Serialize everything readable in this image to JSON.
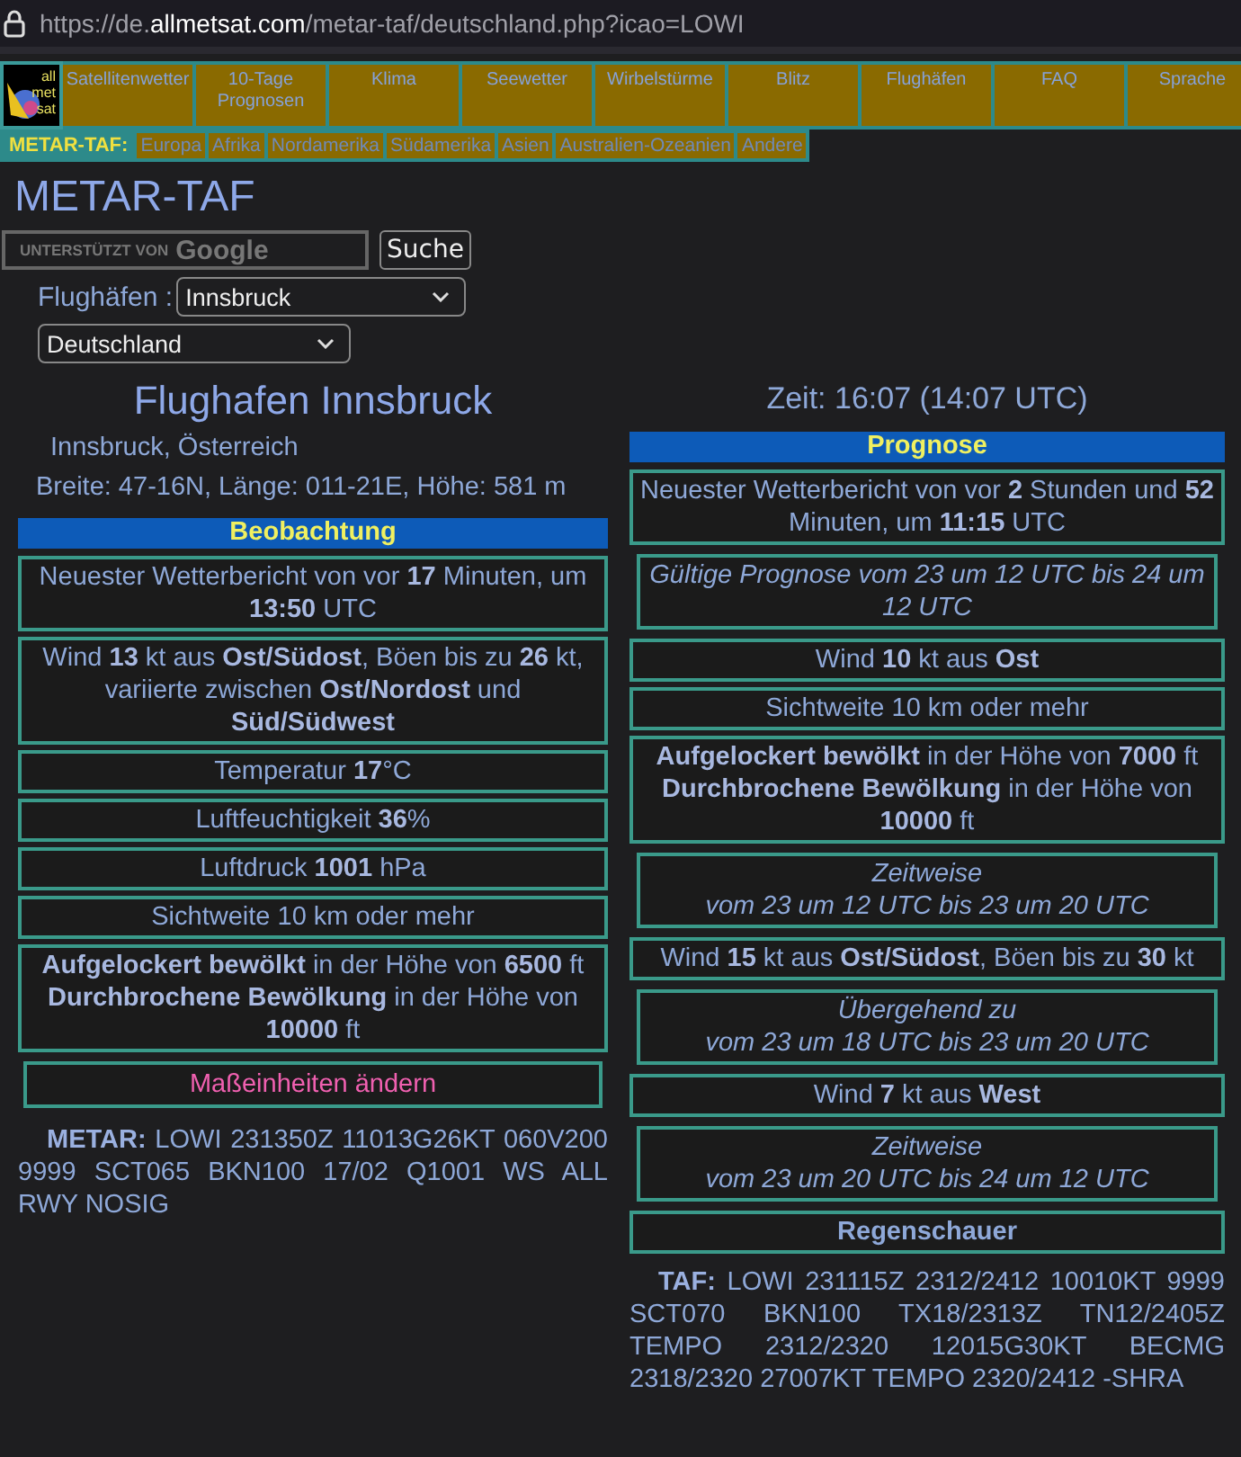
{
  "address_bar": {
    "url": "https://de.**allmetsat.com**/metar-taf/deutschland.php?icao=LOWI"
  },
  "logo": [
    "all",
    "met",
    "sat"
  ],
  "main_nav": [
    "Satellitenwetter",
    "10-Tage Prognosen",
    "Klima",
    "Seewetter",
    "Wirbelstürme",
    "Blitz",
    "Flughäfen",
    "FAQ",
    "Sprache"
  ],
  "sub_nav": {
    "label": "METAR-TAF:",
    "items": [
      "Europa",
      "Afrika",
      "Nordamerika",
      "Südamerika",
      "Asien",
      "Australien-Ozeanien",
      "Andere"
    ]
  },
  "page_title": "METAR-TAF",
  "search": {
    "placeholder": "UNTERSTÜTZT VON **Google**",
    "button": "Suche"
  },
  "airport_select": {
    "label": "Flughäfen :",
    "value": "Innsbruck"
  },
  "country_select": {
    "value": "Deutschland"
  },
  "observation": {
    "title": "Flughafen Innsbruck",
    "location": "Innsbruck, Österreich",
    "coordinates": "Breite: 47-16N, Länge: 011-21E, Höhe: 581 m",
    "section": "Beobachtung",
    "boxes": [
      {
        "kind": "info",
        "text": "Neuester Wetterbericht von vor **17** Minuten, um **13:50** UTC"
      },
      {
        "kind": "info",
        "text": "Wind **13** kt aus **Ost/Südost**, Böen bis zu **26** kt, variierte zwischen **Ost/Nordost** und **Süd/Südwest**"
      },
      {
        "kind": "info",
        "text": "Temperatur **17**°C"
      },
      {
        "kind": "info",
        "text": "Luftfeuchtigkeit **36**%"
      },
      {
        "kind": "info",
        "text": "Luftdruck **1001** hPa"
      },
      {
        "kind": "info",
        "text": "Sichtweite 10 km oder mehr"
      },
      {
        "kind": "info",
        "text": "**Aufgelockert bewölkt** in der Höhe von **6500** ft **Durchbrochene Bewölkung** in der Höhe von **10000** ft"
      },
      {
        "kind": "link",
        "text": "Maßeinheiten ändern"
      }
    ],
    "raw": "**METAR:** LOWI 231350Z 11013G26KT 060V200 9999 SCT065 BKN100 17/02 Q1001 WS ALL RWY NOSIG"
  },
  "forecast": {
    "time": "Zeit: 16:07 (14:07 UTC)",
    "section": "Prognose",
    "boxes": [
      {
        "kind": "info",
        "text": "Neuester Wetterbericht von vor **2** Stunden und **52** Minuten, um **11:15** UTC"
      },
      {
        "kind": "period",
        "text": "Gültige Prognose vom 23 um 12 UTC bis 24 um 12 UTC"
      },
      {
        "kind": "info",
        "text": "Wind **10** kt aus **Ost**"
      },
      {
        "kind": "info",
        "text": "Sichtweite 10 km oder mehr"
      },
      {
        "kind": "info",
        "text": "**Aufgelockert bewölkt** in der Höhe von **7000** ft **Durchbrochene Bewölkung** in der Höhe von **10000** ft"
      },
      {
        "kind": "period",
        "text": "Zeitweise",
        "sub": "vom 23 um 12 UTC bis 23 um 20 UTC"
      },
      {
        "kind": "info",
        "text": "Wind **15** kt aus **Ost/Südost**, Böen bis zu **30** kt"
      },
      {
        "kind": "period",
        "text": "Übergehend zu",
        "sub": "vom 23 um 18 UTC bis 23 um 20 UTC"
      },
      {
        "kind": "info",
        "text": "Wind **7** kt aus **West**"
      },
      {
        "kind": "period",
        "text": "Zeitweise",
        "sub": "vom 23 um 20 UTC bis 24 um 12 UTC"
      },
      {
        "kind": "weather",
        "text": "Regenschauer"
      }
    ],
    "raw": "**TAF:** LOWI 231115Z 2312/2412 10010KT 9999 SCT070 BKN100 TX18/2313Z TN12/2405Z TEMPO 2312/2320 12015G30KT BECMG 2318/2320 27007KT TEMPO 2320/2412 -SHRA"
  }
}
